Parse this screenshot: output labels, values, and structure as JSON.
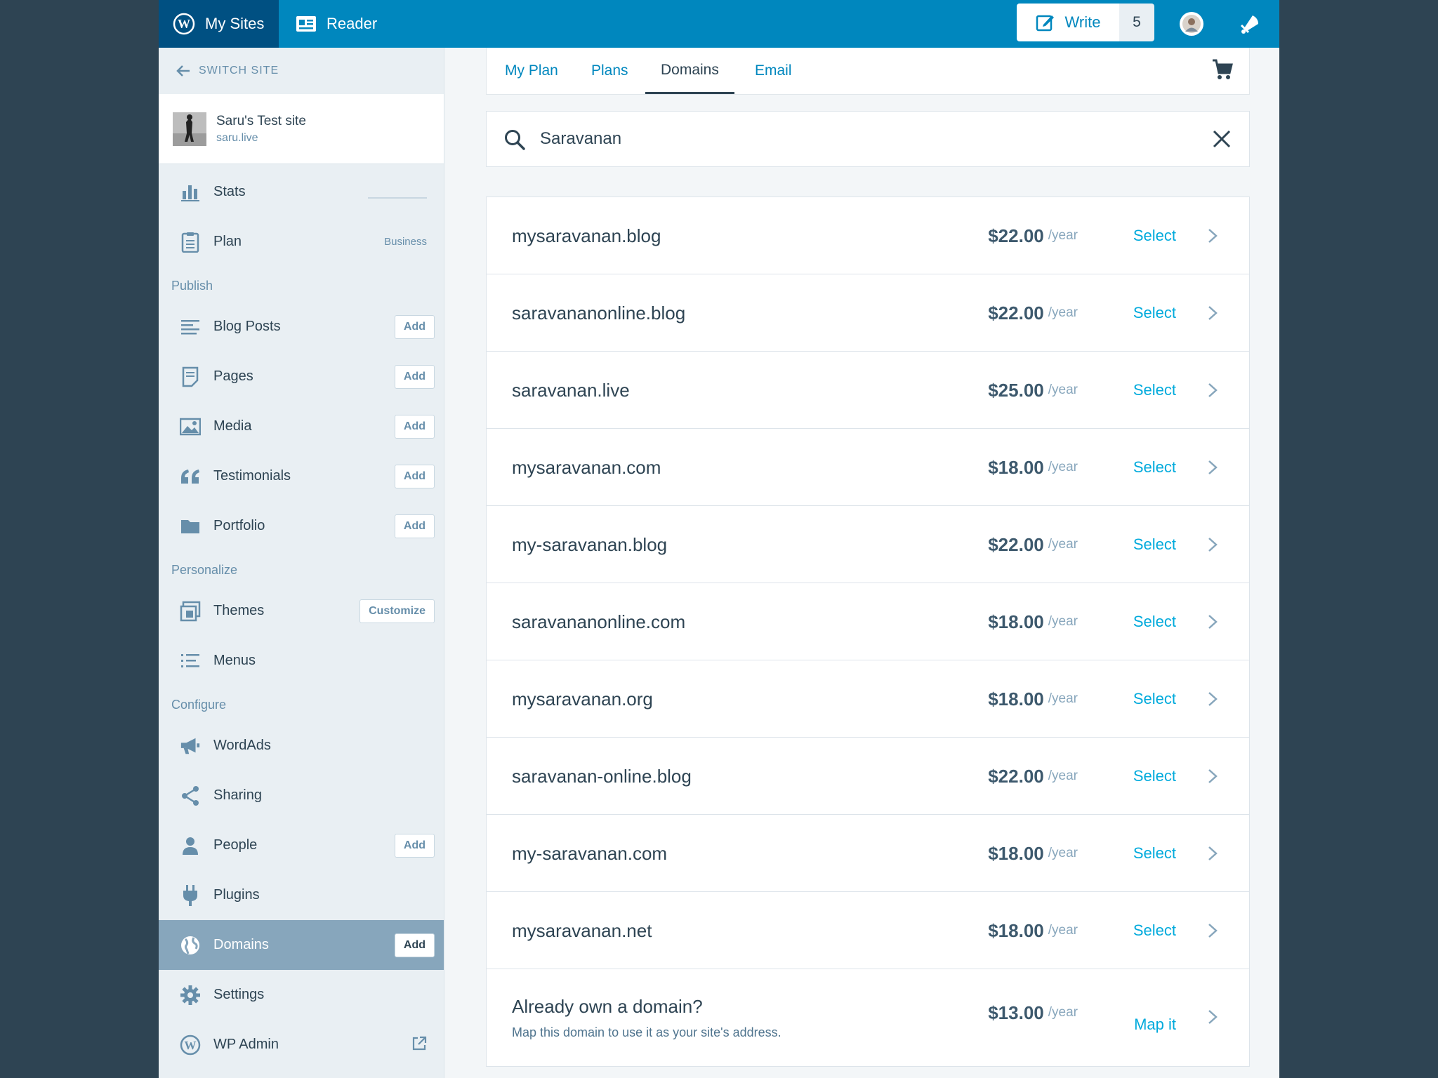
{
  "masterbar": {
    "my_sites": "My Sites",
    "reader": "Reader",
    "write": "Write",
    "write_count": "5"
  },
  "sidebar": {
    "switch_site": "Switch Site",
    "site": {
      "name": "Saru's Test site",
      "url": "saru.live"
    },
    "stats": "Stats",
    "plan": {
      "label": "Plan",
      "badge": "Business"
    },
    "publish_heading": "Publish",
    "publish": [
      {
        "label": "Blog Posts",
        "button": "Add"
      },
      {
        "label": "Pages",
        "button": "Add"
      },
      {
        "label": "Media",
        "button": "Add"
      },
      {
        "label": "Testimonials",
        "button": "Add"
      },
      {
        "label": "Portfolio",
        "button": "Add"
      }
    ],
    "personalize_heading": "Personalize",
    "themes": {
      "label": "Themes",
      "button": "Customize"
    },
    "menus": "Menus",
    "configure_heading": "Configure",
    "wordads": "WordAds",
    "sharing": "Sharing",
    "people": {
      "label": "People",
      "button": "Add"
    },
    "plugins": "Plugins",
    "domains": {
      "label": "Domains",
      "button": "Add"
    },
    "settings": "Settings",
    "wp_admin": "WP Admin"
  },
  "tabs": [
    "My Plan",
    "Plans",
    "Domains",
    "Email"
  ],
  "active_tab": "Domains",
  "search": {
    "value": "Saravanan"
  },
  "results": [
    {
      "domain": "mysaravanan.blog",
      "price": "$22.00",
      "per": "/year",
      "action": "Select"
    },
    {
      "domain": "saravananonline.blog",
      "price": "$22.00",
      "per": "/year",
      "action": "Select"
    },
    {
      "domain": "saravanan.live",
      "price": "$25.00",
      "per": "/year",
      "action": "Select"
    },
    {
      "domain": "mysaravanan.com",
      "price": "$18.00",
      "per": "/year",
      "action": "Select"
    },
    {
      "domain": "my-saravanan.blog",
      "price": "$22.00",
      "per": "/year",
      "action": "Select"
    },
    {
      "domain": "saravananonline.com",
      "price": "$18.00",
      "per": "/year",
      "action": "Select"
    },
    {
      "domain": "mysaravanan.org",
      "price": "$18.00",
      "per": "/year",
      "action": "Select"
    },
    {
      "domain": "saravanan-online.blog",
      "price": "$22.00",
      "per": "/year",
      "action": "Select"
    },
    {
      "domain": "my-saravanan.com",
      "price": "$18.00",
      "per": "/year",
      "action": "Select"
    },
    {
      "domain": "mysaravanan.net",
      "price": "$18.00",
      "per": "/year",
      "action": "Select"
    }
  ],
  "map_domain": {
    "title": "Already own a domain?",
    "description": "Map this domain to use it as your site's address.",
    "price": "$13.00",
    "per": "/year",
    "action": "Map it"
  },
  "colors": {
    "masterbar": "#0087be",
    "sidebar": "#e9eff3",
    "selected": "#87a6bc",
    "link": "#00aadc",
    "text": "#2e4453"
  },
  "icons": {
    "masterbar": [
      "wordpress-icon",
      "reader-icon",
      "write-icon",
      "avatar",
      "notifications-icon"
    ],
    "sidebar": [
      "back-arrow-icon",
      "stats-icon",
      "plan-icon",
      "posts-icon",
      "pages-icon",
      "media-icon",
      "quote-icon",
      "folder-icon",
      "themes-icon",
      "menus-icon",
      "megaphone-icon",
      "share-icon",
      "person-icon",
      "plug-icon",
      "globe-icon",
      "gear-icon",
      "external-icon"
    ],
    "main": [
      "cart-icon",
      "search-icon",
      "close-icon",
      "chevron-right-icon"
    ]
  }
}
